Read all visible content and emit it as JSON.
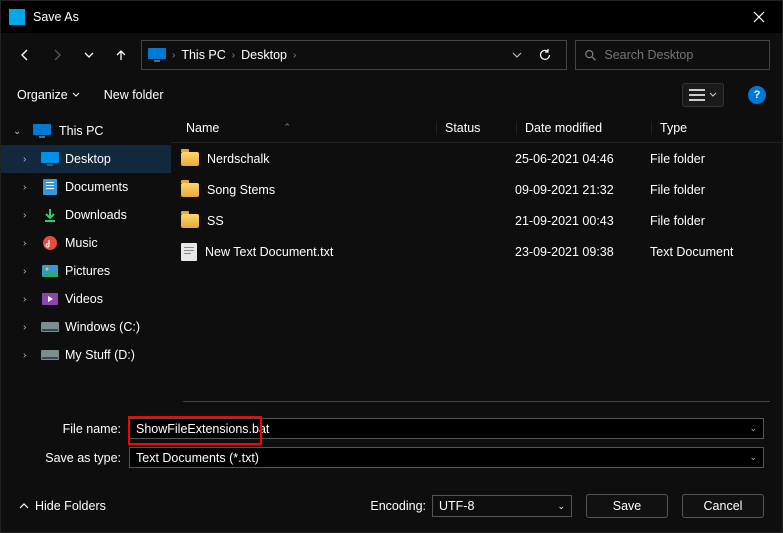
{
  "window": {
    "title": "Save As"
  },
  "breadcrumb": {
    "root": "This PC",
    "folder": "Desktop"
  },
  "search": {
    "placeholder": "Search Desktop"
  },
  "toolbar": {
    "organize": "Organize",
    "newfolder": "New folder"
  },
  "sidebar": {
    "root": "This PC",
    "items": [
      {
        "label": "Desktop"
      },
      {
        "label": "Documents"
      },
      {
        "label": "Downloads"
      },
      {
        "label": "Music"
      },
      {
        "label": "Pictures"
      },
      {
        "label": "Videos"
      },
      {
        "label": "Windows (C:)"
      },
      {
        "label": "My Stuff (D:)"
      }
    ]
  },
  "columns": {
    "name": "Name",
    "status": "Status",
    "date": "Date modified",
    "type": "Type"
  },
  "files": [
    {
      "name": "Nerdschalk",
      "date": "25-06-2021 04:46",
      "type": "File folder",
      "kind": "folder"
    },
    {
      "name": "Song Stems",
      "date": "09-09-2021 21:32",
      "type": "File folder",
      "kind": "folder"
    },
    {
      "name": "SS",
      "date": "21-09-2021 00:43",
      "type": "File folder",
      "kind": "folder"
    },
    {
      "name": "New Text Document.txt",
      "date": "23-09-2021 09:38",
      "type": "Text Document",
      "kind": "txt"
    }
  ],
  "form": {
    "filename_label": "File name:",
    "filename_value": "ShowFileExtensions.bat",
    "savetype_label": "Save as type:",
    "savetype_value": "Text Documents (*.txt)",
    "encoding_label": "Encoding:",
    "encoding_value": "UTF-8",
    "hidefolders": "Hide Folders",
    "save": "Save",
    "cancel": "Cancel"
  }
}
